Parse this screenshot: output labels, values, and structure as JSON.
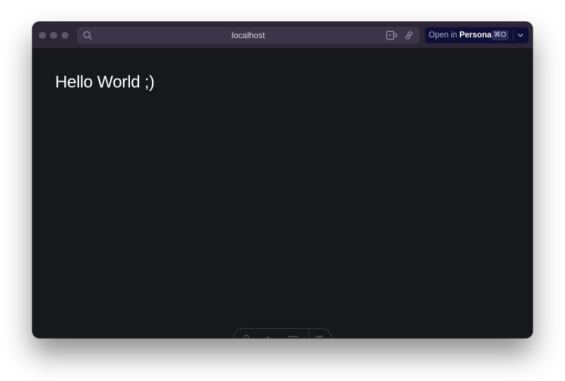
{
  "window": {
    "toolbar": {
      "url": "localhost",
      "open_button": {
        "prefix": "Open in",
        "target": "Personal",
        "shortcut": "⌘O"
      }
    }
  },
  "page": {
    "heading": "Hello World ;)"
  },
  "colors": {
    "window_bg": "#17181c",
    "titlebar_bg": "#2c2637",
    "urlbar_bg": "#3b354a",
    "open_button_bg": "#0f0f35",
    "text": "#ffffff"
  },
  "icons": {
    "url_search": "search-icon",
    "extensions": "extension-icon",
    "copy_link": "link-icon",
    "dropdown": "chevron-down-icon"
  }
}
